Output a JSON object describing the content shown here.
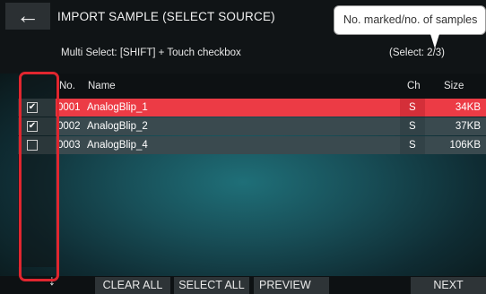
{
  "header": {
    "back_icon": "←",
    "title": "IMPORT SAMPLE (SELECT SOURCE)",
    "hint": "Multi Select: [SHIFT] + Touch checkbox",
    "select_count": "(Select:   2/3)"
  },
  "callout": {
    "text": "No. marked/no. of samples"
  },
  "table": {
    "columns": {
      "no": "No.",
      "name": "Name",
      "ch": "Ch",
      "size": "Size"
    },
    "rows": [
      {
        "checked": true,
        "check_glyph": "✔",
        "no": "0001",
        "name": "AnalogBlip_1",
        "ch": "S",
        "size": "34KB",
        "selected": true
      },
      {
        "checked": true,
        "check_glyph": "✔",
        "no": "0002",
        "name": "AnalogBlip_2",
        "ch": "S",
        "size": "37KB",
        "selected": false
      },
      {
        "checked": false,
        "check_glyph": "",
        "no": "0003",
        "name": "AnalogBlip_4",
        "ch": "S",
        "size": "106KB",
        "selected": false
      }
    ]
  },
  "footer": {
    "down_arrow": "↓",
    "clear_all": "CLEAR ALL",
    "select_all": "SELECT ALL",
    "preview": "PREVIEW",
    "next": "NEXT"
  },
  "colors": {
    "selected_row": "#ec3b45",
    "highlight_border": "#e0262f",
    "accent_teal": "#3aa6a0"
  }
}
